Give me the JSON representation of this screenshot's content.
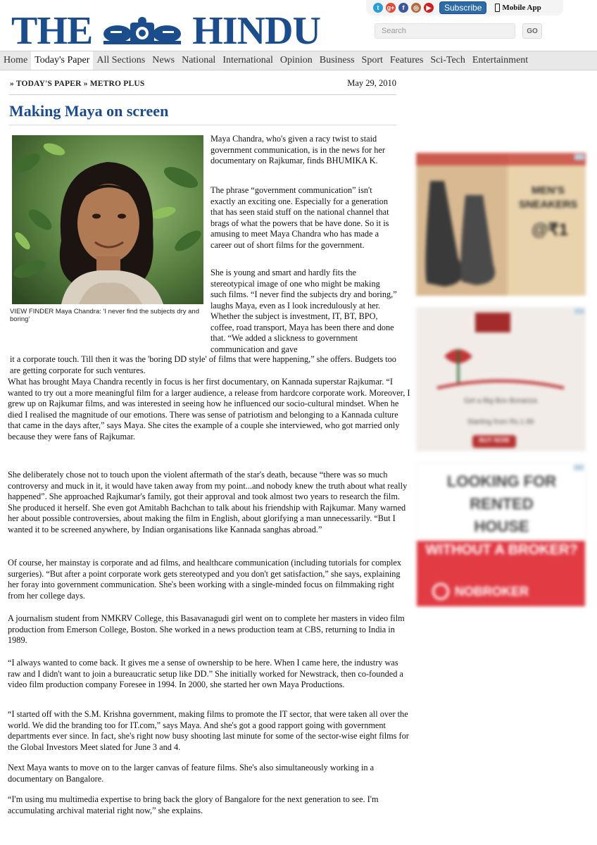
{
  "header": {
    "logo_left": "THE",
    "logo_right": "HINDU",
    "search_placeholder": "Search",
    "go_label": "GO",
    "subscribe_label": "Subscribe",
    "mobile_app_label": "Mobile App",
    "social_icons": [
      "twitter-icon",
      "google-plus-icon",
      "facebook-icon",
      "instagram-icon",
      "youtube-icon"
    ]
  },
  "nav": {
    "items": [
      "Home",
      "Today's Paper",
      "All Sections",
      "News",
      "National",
      "International",
      "Opinion",
      "Business",
      "Sport",
      "Features",
      "Sci-Tech",
      "Entertainment"
    ],
    "active": "Today's Paper"
  },
  "article": {
    "breadcrumb": "» TODAY'S PAPER » METRO PLUS",
    "date": "May 29, 2010",
    "headline": "Making Maya on screen",
    "caption": "VIEW FINDER Maya Chandra: 'I never find the subjects dry and boring'",
    "standfirst": "Maya Chandra, who's given a racy twist to staid government communication, is in the news for her documentary on Rajkumar, finds BHUMIKA K.",
    "p1": "The phrase “government communication” isn't exactly an exciting one. Especially for a generation that has seen staid stuff on the national channel that brags of what the powers that be have done. So it is amusing to meet Maya Chandra who has made a career out of short films for the government.",
    "p2": "She is young and smart and hardly fits the stereotypical image of one who might be making such films. “I never find the subjects dry and boring,” laughs Maya, even as I look incredulously at her. Whether the subject is investment, IT, BT, BPO, coffee, road transport, Maya has been there and done that. “We added a slickness to government communication and gave",
    "p2_cont": "it a corporate touch. Till then it was the 'boring DD style' of films that were happening,” she offers. Budgets too are getting corporate for such ventures.",
    "p3": "What has brought Maya Chandra recently in focus is her first documentary, on Kannada superstar Rajkumar. “I wanted to try out a more meaningful film for a larger audience, a release from hardcore corporate work. Moreover, I grew up on Rajkumar films, and was interested in seeing how he influenced our socio-cultural mindset. When he died I realised the magnitude of our emotions. There was sense of patriotism and belonging to a Kannada culture that came in the days after,” says Maya. She cites the example of a couple she interviewed, who got married only because they were fans of Rajkumar.",
    "p4": "She deliberately chose not to touch upon the violent aftermath of the star's death, because “there was so much controversy and muck in it, it would have taken away from my point...and nobody knew the truth about what really happened”. She approached Rajkumar's family, got their approval and took almost two years to research the film. She produced it herself. She even got Amitabh Bachchan to talk about his friendship with Rajkumar. Many warned her about possible controversies, about making the film in English, about glorifying a man unnecessarily. “But I wanted it to be screened anywhere, by Indian organisations like Kannada sanghas abroad.”",
    "p5": "Of course, her mainstay is corporate and ad films, and healthcare communication (including tutorials for complex surgeries). “But after a point corporate work gets stereotyped and you don't get satisfaction,” she says, explaining her foray into government communication. She's been working with a single-minded focus on filmmaking right from her college days.",
    "p6": "A journalism student from NMKRV College, this Basavanagudi girl went on to complete her masters in video film production from Emerson College, Boston. She worked in a news production team at CBS, returning to India in 1989.",
    "p7": "“I always wanted to come back. It gives me a sense of ownership to be here. When I came here, the industry was raw and I didn't want to join a bureaucratic setup like DD.” She initially worked for Newstrack, then co-founded a video film production company Foresee in 1994. In 2000, she started her own Maya Productions.",
    "p8": "“I started off with the S.M. Krishna government, making films to promote the IT sector, that were taken all over the world. We did the branding too for IT.com,” says Maya. And she's got a good rapport going with government departments ever since. In fact, she's right now busy shooting last minute for some of the sector-wise eight films for the Global Investors Meet slated for June 3 and 4.",
    "p9": "Next Maya wants to move on to the larger canvas of feature films. She's also simultaneously working in a documentary on Bangalore.",
    "p10": "“I'm using mu multimedia expertise to bring back the glory of Bangalore for the next generation to see. I'm accumulating archival material right now,” she explains."
  },
  "ads": {
    "ad1": {
      "headline": "MEN'S SNEAKERS",
      "price": "@₹1"
    },
    "ad2": {
      "line1": "Get a Big Box Bonanza",
      "line2": "Starting from Rs.1.99",
      "cta": "BUY NOW"
    },
    "ad3": {
      "line1": "LOOKING FOR",
      "line2": "RENTED",
      "line3": "HOUSE",
      "line4": "WITHOUT A BROKER?",
      "brand": "NOBROKER"
    }
  },
  "colors": {
    "brand_blue": "#1b4d8c",
    "nav_bg": "#e8e8e8",
    "ad_red": "#e23b44"
  }
}
